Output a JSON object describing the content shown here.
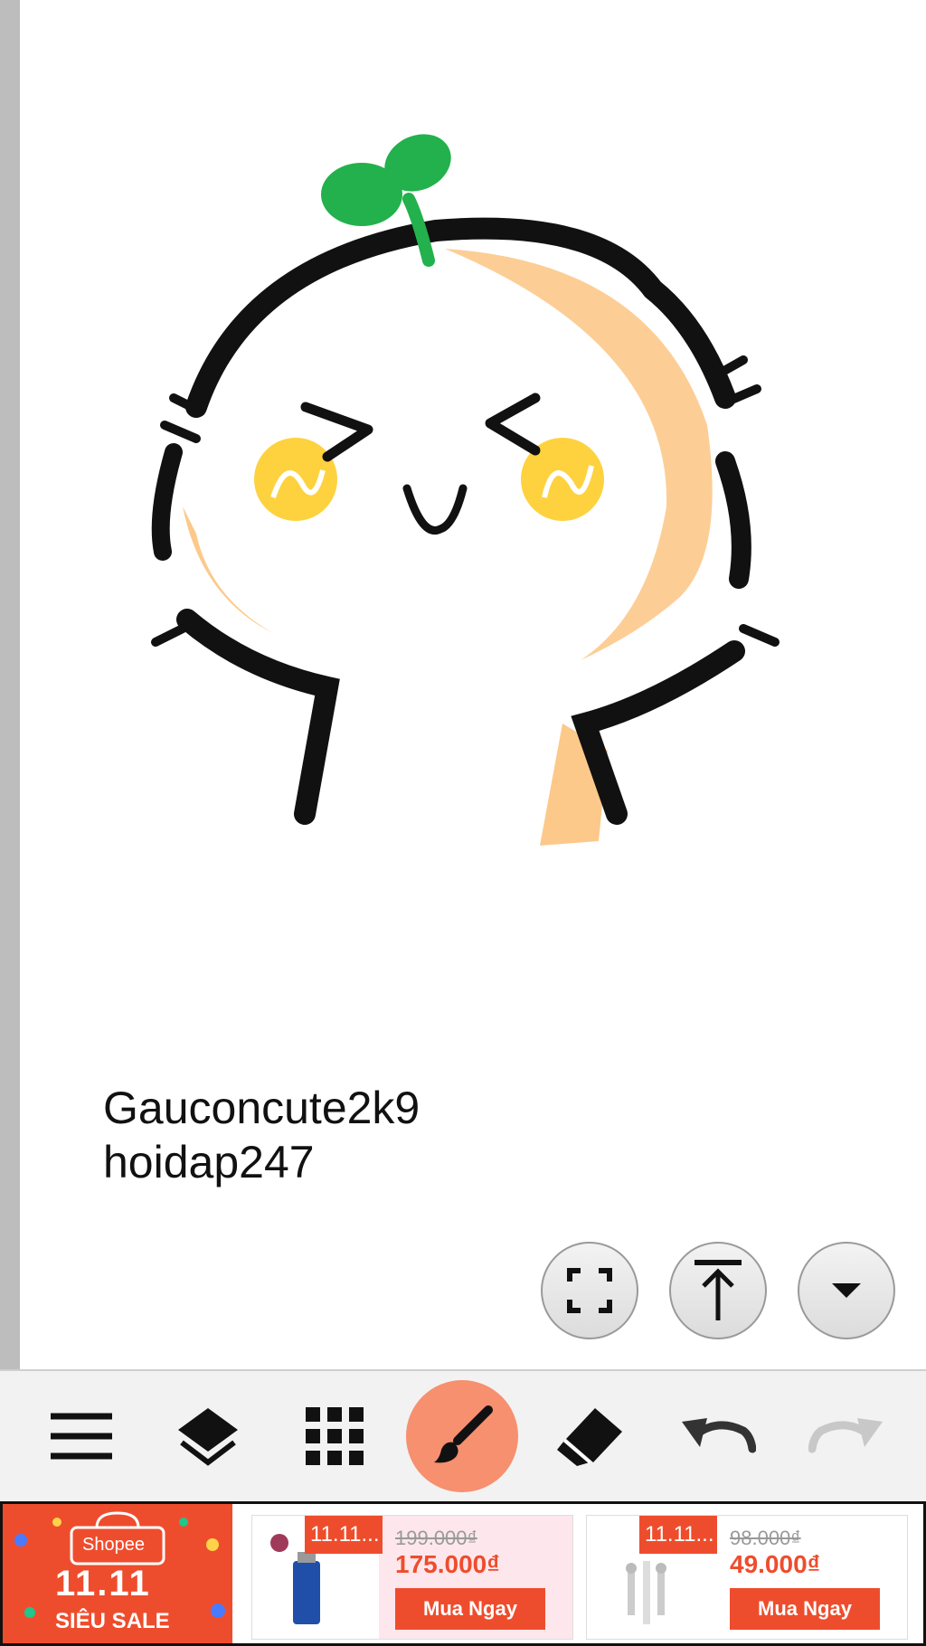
{
  "caption": {
    "line1": "Gauconcute2k9",
    "line2": "hoidap247"
  },
  "icons": {
    "fullscreen": "fullscreen-icon",
    "scroll_top": "scroll-top-icon",
    "dropdown": "caret-down-icon",
    "menu": "menu-icon",
    "layers": "layers-icon",
    "grid": "grid-icon",
    "brush": "brush-icon",
    "eraser": "eraser-icon",
    "undo": "undo-icon",
    "redo": "redo-icon"
  },
  "colors": {
    "accent": "#f6906f",
    "shopee": "#ee4d2d",
    "sprout": "#22b14c",
    "cheek": "#fdd23e",
    "shade": "#fcc98a"
  },
  "ad": {
    "brand": "Shopee",
    "event": "11.11",
    "event_label": "SIÊU SALE",
    "products": [
      {
        "tag": "11.11...",
        "old_price": "199.000₫",
        "new_price": "175.000₫",
        "button": "Mua Ngay"
      },
      {
        "tag": "11.11...",
        "old_price": "98.000₫",
        "new_price": "49.000₫",
        "button": "Mua Ngay"
      }
    ]
  }
}
